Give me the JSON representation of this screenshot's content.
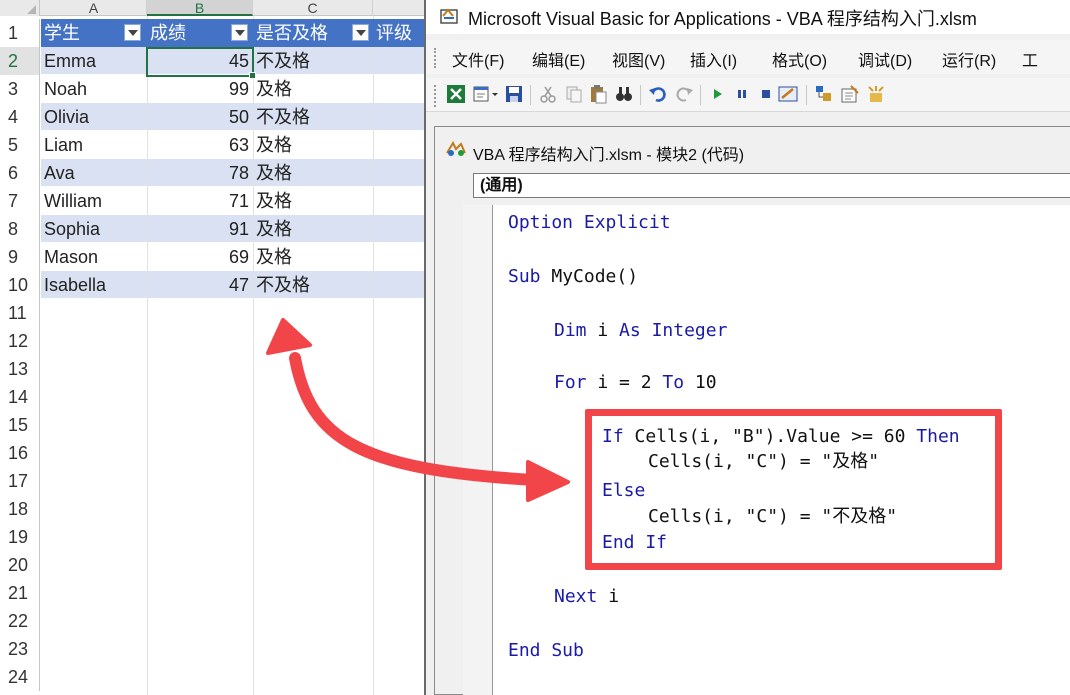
{
  "spreadsheet": {
    "column_headers": [
      "A",
      "B",
      "C"
    ],
    "row_numbers": [
      "1",
      "2",
      "3",
      "4",
      "5",
      "6",
      "7",
      "8",
      "9",
      "10",
      "11",
      "12",
      "13",
      "14",
      "15",
      "16",
      "17",
      "18",
      "19",
      "20",
      "21",
      "22",
      "23",
      "24"
    ],
    "table_headers": [
      "学生",
      "成绩",
      "是否及格",
      "评级"
    ],
    "rows": [
      {
        "name": "Emma",
        "score": "45",
        "result": "不及格"
      },
      {
        "name": "Noah",
        "score": "99",
        "result": "及格"
      },
      {
        "name": "Olivia",
        "score": "50",
        "result": "不及格"
      },
      {
        "name": "Liam",
        "score": "63",
        "result": "及格"
      },
      {
        "name": "Ava",
        "score": "78",
        "result": "及格"
      },
      {
        "name": "William",
        "score": "71",
        "result": "及格"
      },
      {
        "name": "Sophia",
        "score": "91",
        "result": "及格"
      },
      {
        "name": "Mason",
        "score": "69",
        "result": "及格"
      },
      {
        "name": "Isabella",
        "score": "47",
        "result": "不及格"
      }
    ],
    "table_header_color": "#4472c4",
    "band_color": "#d9e1f2",
    "selection_color": "#217346"
  },
  "vbe": {
    "title": "Microsoft Visual Basic for Applications - VBA 程序结构入门.xlsm",
    "menu": [
      "文件(F)",
      "编辑(E)",
      "视图(V)",
      "插入(I)",
      "格式(O)",
      "调试(D)",
      "运行(R)",
      "工"
    ],
    "code_window": {
      "title": "VBA 程序结构入门.xlsm - 模块2 (代码)",
      "object_combo": "(通用)"
    },
    "code": {
      "l1": "Option Explicit",
      "l2": "Sub MyCode()",
      "l3": "Dim i As Integer",
      "l4": "For i = 2 To 10",
      "l5": "If Cells(i, \"B\").Value >= 60 Then",
      "l6": "Cells(i, \"C\") = \"及格\"",
      "l7": "Else",
      "l8": "Cells(i, \"C\") = \"不及格\"",
      "l9": "End If",
      "l10": "Next i",
      "l11": "End Sub"
    },
    "keyword_color": "#1a1aa6"
  },
  "annotation": {
    "highlight_color": "#f2454a"
  }
}
